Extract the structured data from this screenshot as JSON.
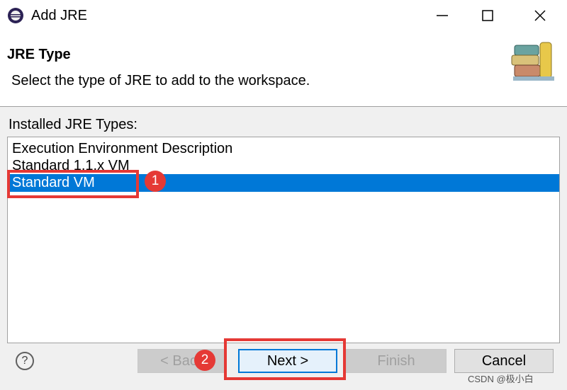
{
  "window": {
    "title": "Add JRE",
    "controls": [
      "minimize",
      "maximize",
      "close"
    ]
  },
  "header": {
    "title": "JRE Type",
    "description": "Select the type of JRE to add to the workspace."
  },
  "list": {
    "label": "Installed JRE Types:",
    "items": [
      {
        "label": "Execution Environment Description",
        "selected": false
      },
      {
        "label": "Standard 1.1.x VM",
        "selected": false
      },
      {
        "label": "Standard VM",
        "selected": true
      }
    ]
  },
  "annotations": {
    "badge1": "1",
    "badge2": "2",
    "color": "#e53935"
  },
  "buttons": {
    "help": "?",
    "back": "< Back",
    "next": "Next >",
    "finish": "Finish",
    "cancel": "Cancel"
  },
  "watermark": "CSDN @极小白",
  "colors": {
    "selection": "#0078d7",
    "annotation": "#e53935"
  }
}
